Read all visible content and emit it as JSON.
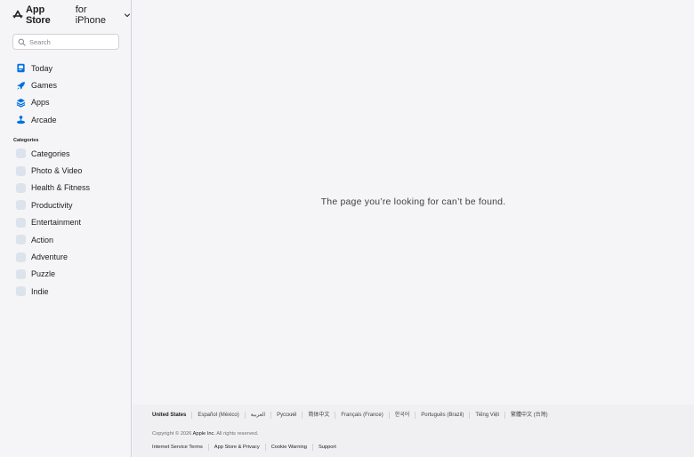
{
  "header": {
    "brand": "App Store",
    "platform": "for iPhone",
    "logo_icon": "apple-logo-icon",
    "dropdown_icon": "chevron-down-icon"
  },
  "search": {
    "placeholder": "Search",
    "icon": "search-icon"
  },
  "nav": {
    "items": [
      {
        "label": "Today",
        "icon": "today-icon"
      },
      {
        "label": "Games",
        "icon": "rocket-icon"
      },
      {
        "label": "Apps",
        "icon": "apps-stack-icon"
      },
      {
        "label": "Arcade",
        "icon": "joystick-icon"
      }
    ]
  },
  "categories": {
    "heading": "Categories",
    "items": [
      {
        "label": "Categories",
        "icon": "categories-icon"
      },
      {
        "label": "Photo & Video",
        "icon": "photo-video-icon"
      },
      {
        "label": "Health & Fitness",
        "icon": "health-fitness-icon"
      },
      {
        "label": "Productivity",
        "icon": "productivity-icon"
      },
      {
        "label": "Entertainment",
        "icon": "entertainment-icon"
      },
      {
        "label": "Action",
        "icon": "action-icon"
      },
      {
        "label": "Adventure",
        "icon": "adventure-icon"
      },
      {
        "label": "Puzzle",
        "icon": "puzzle-icon"
      },
      {
        "label": "Indie",
        "icon": "indie-icon"
      }
    ]
  },
  "main": {
    "message": "The page you’re looking for can’t be found."
  },
  "footer": {
    "languages": [
      "United States",
      "Español (México)",
      "العربية",
      "Русский",
      "简体中文",
      "Français (France)",
      "한국어",
      "Português (Brazil)",
      "Tiếng Việt",
      "繁體中文 (台灣)"
    ],
    "copyright_prefix": "Copyright © 2026",
    "company": "Apple Inc.",
    "rights": "All rights reserved.",
    "legal_links": [
      "Internet Service Terms",
      "App Store & Privacy",
      "Cookie Warning",
      "Support"
    ]
  },
  "colors": {
    "accent_blue": "#0071e3",
    "sidebar_bg": "#f5f5f7",
    "footer_bg": "#f0f0f2"
  }
}
